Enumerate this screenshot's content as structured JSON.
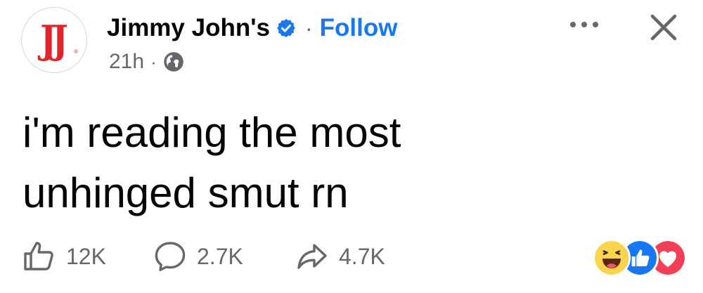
{
  "post": {
    "avatar_text": "JJ",
    "avatar_reg": "®",
    "page_name": "Jimmy John's",
    "separator": "·",
    "follow_label": "Follow",
    "time_ago": "21h",
    "meta_separator": "·",
    "audience_icon": "globe-icon",
    "message_line1": "i'm reading the most",
    "message_line2": "unhinged smut rn"
  },
  "stats": {
    "likes": "12K",
    "comments": "2.7K",
    "shares": "4.7K"
  },
  "reactions": [
    "haha",
    "like",
    "love"
  ],
  "colors": {
    "brand_red": "#e2242b",
    "facebook_blue": "#1877f2",
    "secondary_text": "#65676b",
    "love_red": "#f33e58",
    "haha_yellow": "#fcd34d"
  }
}
